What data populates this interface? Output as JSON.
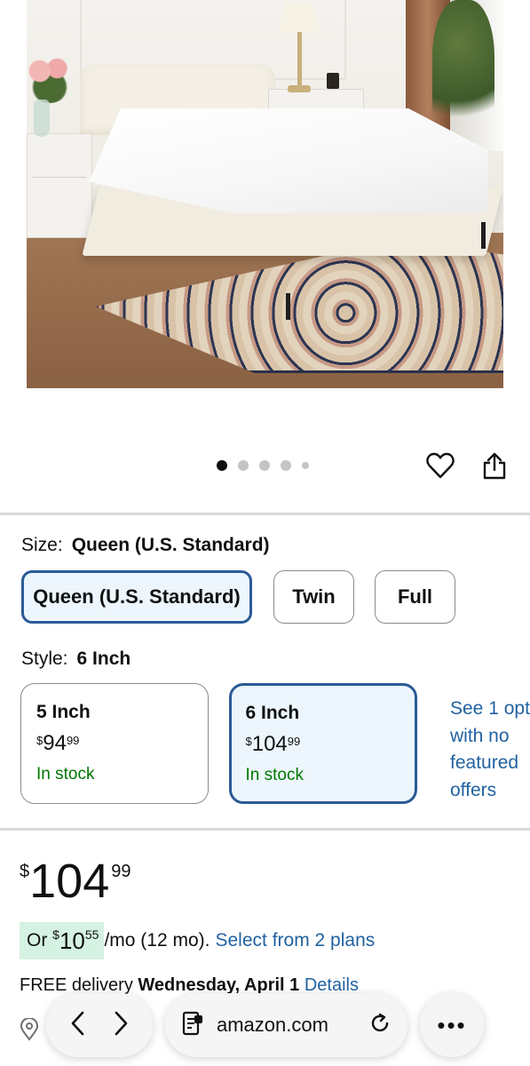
{
  "product_image": {
    "dots": 5,
    "active_index": 0
  },
  "icons": {
    "heart": "heart-icon",
    "share": "share-icon",
    "location": "location-pin-icon",
    "back": "chevron-left-icon",
    "forward": "chevron-right-icon",
    "page": "page-menu-icon",
    "reload": "reload-icon",
    "more": "more-icon"
  },
  "size": {
    "label": "Size:",
    "value": "Queen (U.S. Standard)",
    "options": [
      "Queen (U.S. Standard)",
      "Twin",
      "Full"
    ],
    "selected_index": 0
  },
  "style": {
    "label": "Style:",
    "value": "6 Inch",
    "options": [
      {
        "name": "5 Inch",
        "currency": "$",
        "whole": "94",
        "fraction": "99",
        "stock": "In stock"
      },
      {
        "name": "6 Inch",
        "currency": "$",
        "whole": "104",
        "fraction": "99",
        "stock": "In stock"
      }
    ],
    "selected_index": 1,
    "see_options": "See 1 opt with no featured offers"
  },
  "price": {
    "currency": "$",
    "whole": "104",
    "fraction": "99"
  },
  "monthly": {
    "prefix": "Or",
    "currency": "$",
    "whole": "10",
    "fraction": "55",
    "suffix": "/mo (12 mo).",
    "link": "Select from 2 plans"
  },
  "delivery": {
    "text": "FREE delivery",
    "date": "Wednesday, April 1",
    "link": "Details"
  },
  "browser": {
    "url": "amazon.com",
    "more_label": "•••"
  },
  "colors": {
    "link": "#2162a1",
    "selected_border": "#2a5a95",
    "selected_bg": "#edf6fd",
    "in_stock": "#007600",
    "promo_bg": "#d5f2e2"
  }
}
